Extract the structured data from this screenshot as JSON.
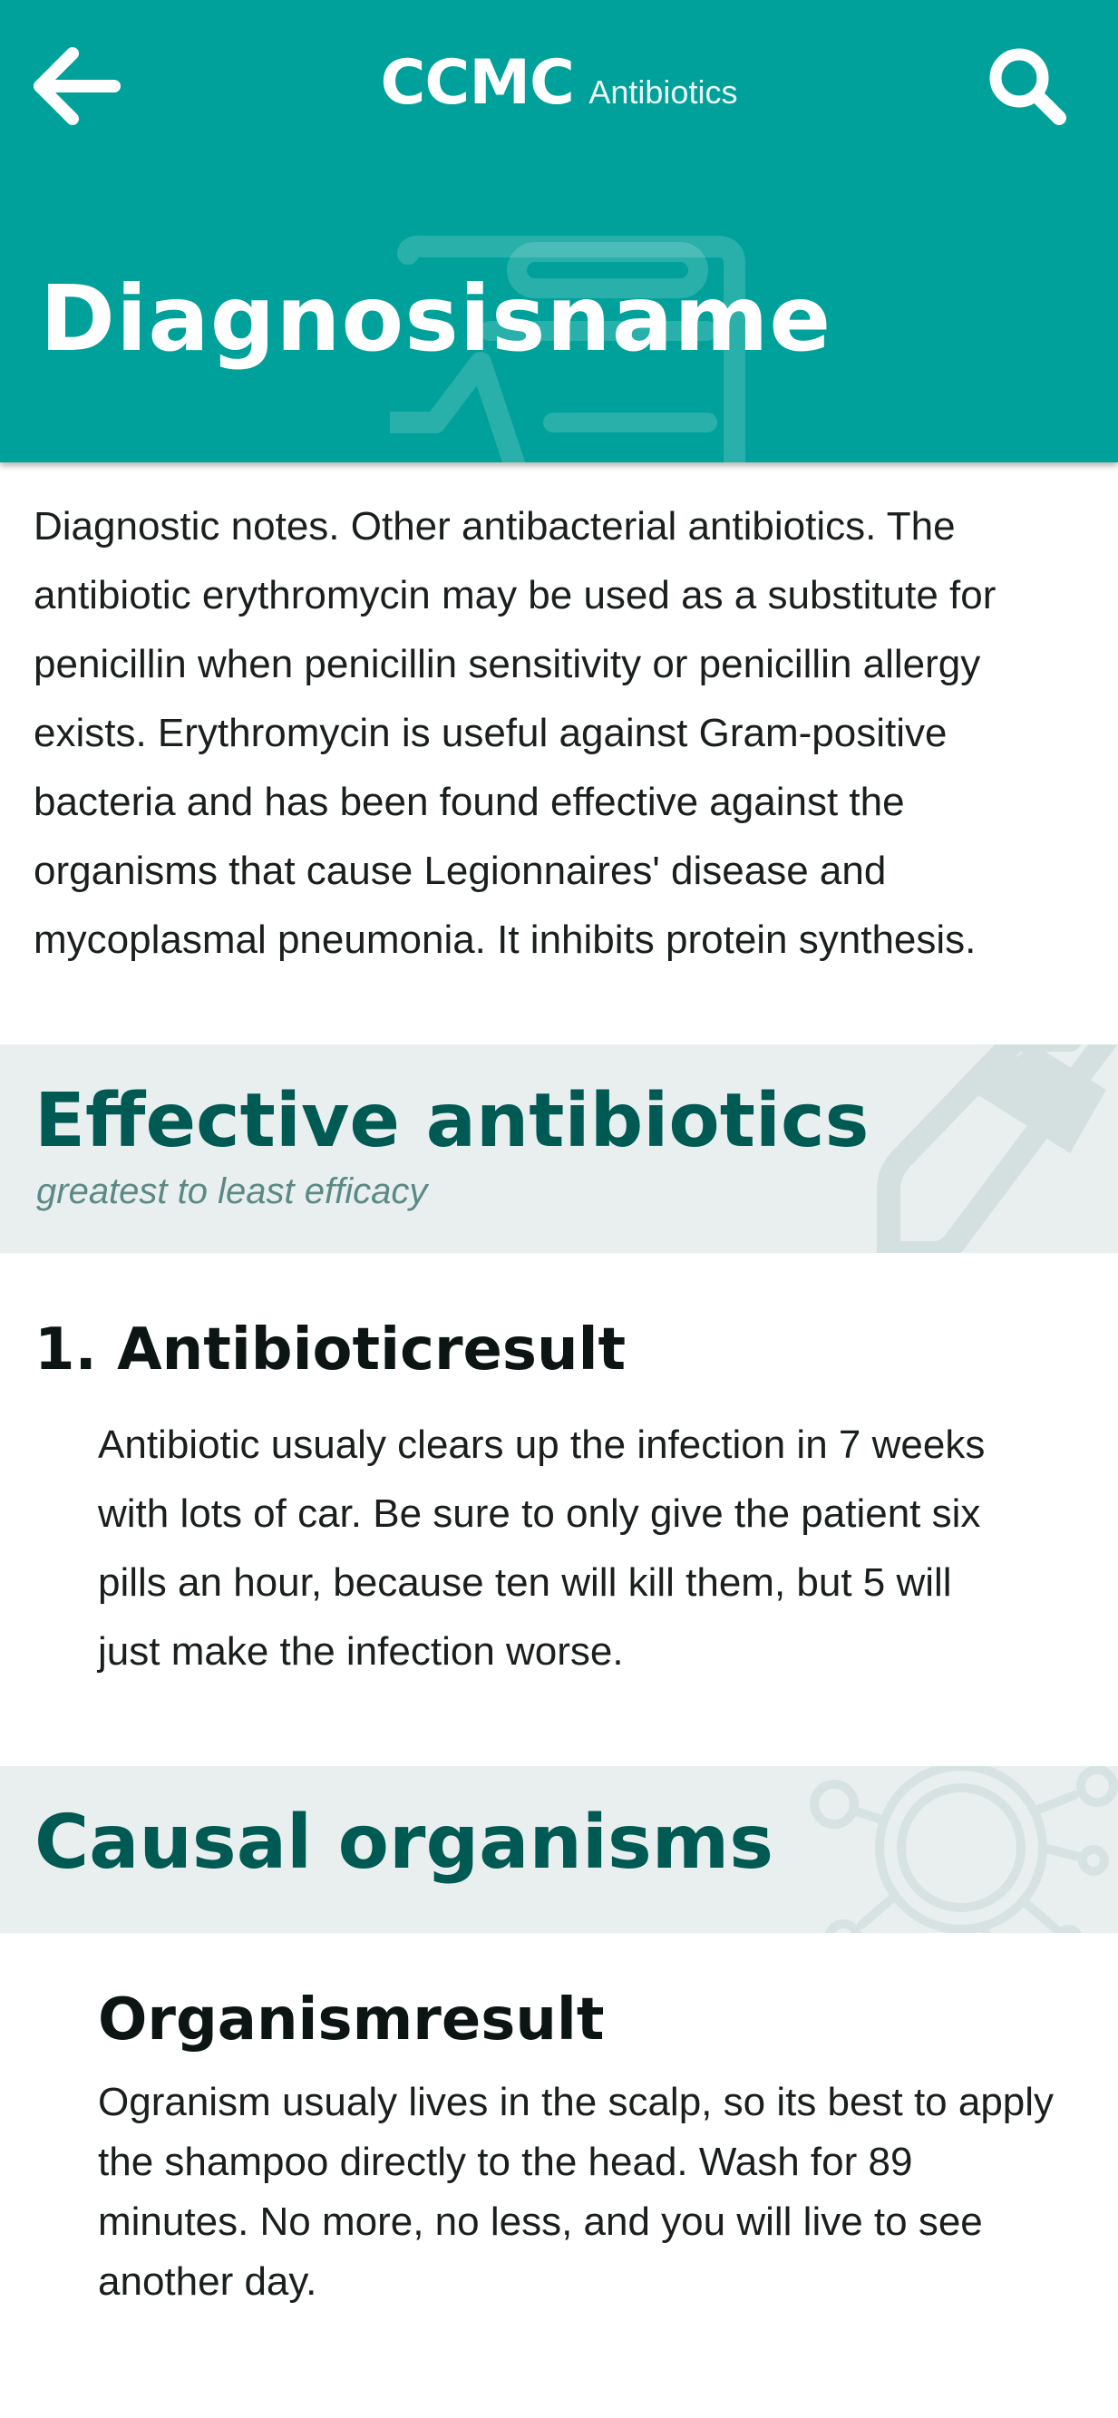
{
  "header": {
    "brand": "CCMC",
    "section": "Antibiotics",
    "title": "Diagnosisname",
    "background_color": "#00a19a",
    "back_icon": "arrow-left-icon",
    "search_icon": "search-icon",
    "decoration_icon": "medical-kit-heartbeat-icon"
  },
  "diagnosis": {
    "notes": "Diagnostic notes. Other antibacterial antibiotics. The antibiotic erythromycin may be used as a substitute for penicillin when penicillin sensitivity or penicillin allergy exists. Erythromycin is useful against Gram-positive bacteria and has been found effective against the organisms that cause Legionnaires' disease and mycoplasmal pneumonia. It inhibits protein synthesis."
  },
  "antibiotics_section": {
    "title": "Effective antibiotics",
    "subtitle": "greatest to least efficacy",
    "decoration_icon": "pill-icon",
    "items": [
      {
        "name": "1. Antibioticresult",
        "description": "Antibiotic usualy clears up the infection in 7 weeks with lots of car. Be sure to only give the patient six pills an hour, because ten will kill them, but 5 will just make the infection worse."
      }
    ]
  },
  "organisms_section": {
    "title": "Causal organisms",
    "decoration_icon": "virus-icon",
    "items": [
      {
        "name": "Organismresult",
        "description": "Ogranism usualy lives in the scalp, so its best to apply the shampoo directly to the head. Wash for 89 minutes. No more, no less, and you will live to see another day."
      }
    ]
  },
  "colors": {
    "primary": "#00a19a",
    "section_title": "#005a54",
    "section_background": "#e9efef",
    "subtitle": "#5b8a86"
  }
}
